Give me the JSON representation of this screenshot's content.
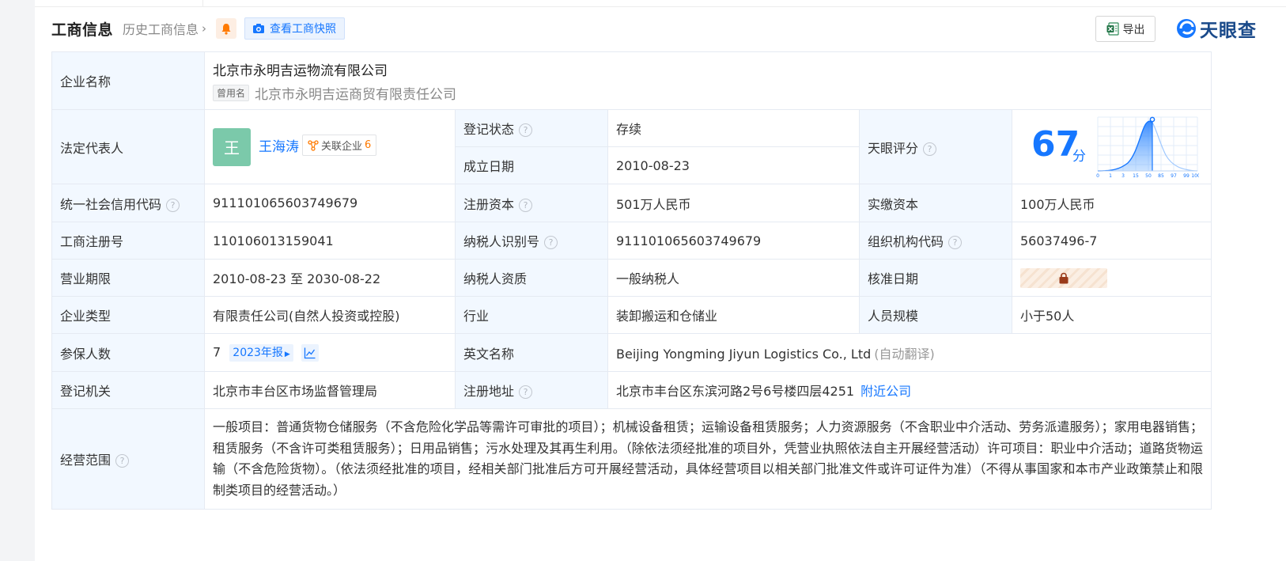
{
  "header": {
    "title": "工商信息",
    "history_label": "历史工商信息",
    "snapshot_label": "查看工商快照",
    "export_label": "导出",
    "logo_text": "天眼查"
  },
  "company": {
    "label": "企业名称",
    "name": "北京市永明吉运物流有限公司",
    "former_tag": "曾用名",
    "former_name": "北京市永明吉运商贸有限责任公司"
  },
  "legal_rep": {
    "label": "法定代表人",
    "avatar_char": "王",
    "name": "王海涛",
    "related_label": "关联企业",
    "related_count": "6"
  },
  "reg_status": {
    "label": "登记状态",
    "value": "存续"
  },
  "founded": {
    "label": "成立日期",
    "value": "2010-08-23"
  },
  "score": {
    "label": "天眼评分",
    "value": "67",
    "unit": "分",
    "axis_ticks": [
      "0",
      "1",
      "3",
      "15",
      "50",
      "85",
      "97",
      "99",
      "100"
    ]
  },
  "rows": {
    "credit_code": {
      "label": "统一社会信用代码",
      "value": "911101065603749679"
    },
    "reg_capital": {
      "label": "注册资本",
      "value": "501万人民币"
    },
    "paid_capital": {
      "label": "实缴资本",
      "value": "100万人民币"
    },
    "reg_no": {
      "label": "工商注册号",
      "value": "110106013159041"
    },
    "taxpayer_id": {
      "label": "纳税人识别号",
      "value": "911101065603749679"
    },
    "org_code": {
      "label": "组织机构代码",
      "value": "56037496-7"
    },
    "biz_term": {
      "label": "营业期限",
      "value": "2010-08-23 至 2030-08-22"
    },
    "taxpayer_qual": {
      "label": "纳税人资质",
      "value": "一般纳税人"
    },
    "approval_date": {
      "label": "核准日期"
    },
    "company_type": {
      "label": "企业类型",
      "value": "有限责任公司(自然人投资或控股)"
    },
    "industry": {
      "label": "行业",
      "value": "装卸搬运和仓储业"
    },
    "staff_size": {
      "label": "人员规模",
      "value": "小于50人"
    },
    "insured": {
      "label": "参保人数",
      "value": "7",
      "year_tag": "2023年报"
    },
    "english_name": {
      "label": "英文名称",
      "value": "Beijing Yongming Jiyun Logistics Co., Ltd",
      "note": "(自动翻译)"
    },
    "reg_authority": {
      "label": "登记机关",
      "value": "北京市丰台区市场监督管理局"
    },
    "reg_address": {
      "label": "注册地址",
      "value": "北京市丰台区东滨河路2号6号楼四层4251",
      "link": "附近公司"
    },
    "scope": {
      "label": "经营范围",
      "value": "一般项目：普通货物仓储服务（不含危险化学品等需许可审批的项目）；机械设备租赁；运输设备租赁服务；人力资源服务（不含职业中介活动、劳务派遣服务）；家用电器销售；租赁服务（不含许可类租赁服务）；日用品销售；污水处理及其再生利用。（除依法须经批准的项目外，凭营业执照依法自主开展经营活动）许可项目：职业中介活动；道路货物运输（不含危险货物）。（依法须经批准的项目，经相关部门批准后方可开展经营活动，具体经营项目以相关部门批准文件或许可证件为准）（不得从事国家和本市产业政策禁止和限制类项目的经营活动。）"
    }
  },
  "colors": {
    "label_bg": "#f2f8ff",
    "accent": "#1677ff",
    "status_green": "#2fa54f",
    "orange": "#ff7a00"
  }
}
